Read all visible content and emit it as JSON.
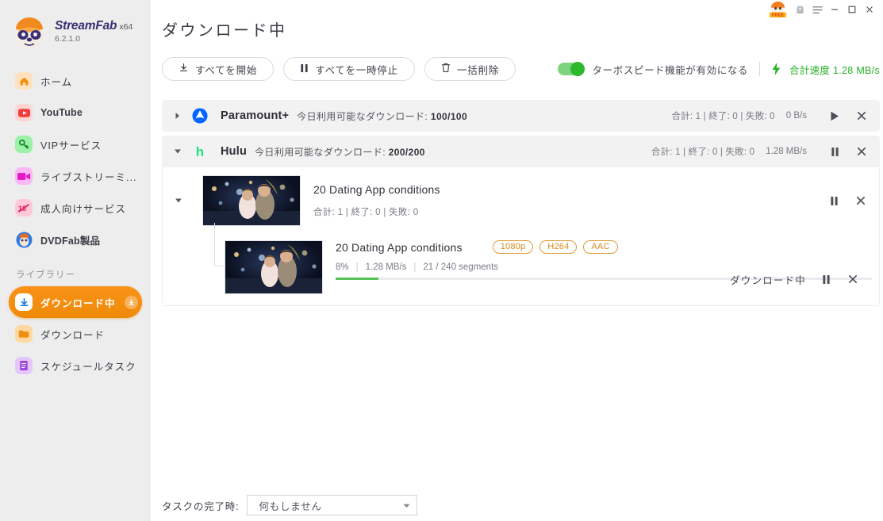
{
  "brand": {
    "name": "StreamFab",
    "arch": "x64",
    "version": "6.2.1.0"
  },
  "titlebar": {
    "free_badge": "free-badge-icon",
    "gift": "gift-icon",
    "menu": "hamburger-menu-icon",
    "minimize": "minimize-icon",
    "maximize": "maximize-icon",
    "close": "close-icon"
  },
  "sidebar": {
    "items": [
      {
        "label": "ホーム",
        "icon": "home-icon",
        "key": "home"
      },
      {
        "label": "YouTube",
        "icon": "youtube-icon",
        "key": "youtube"
      },
      {
        "label": "VIPサービス",
        "icon": "key-icon",
        "key": "vip"
      },
      {
        "label": "ライブストリーミ...",
        "icon": "video-camera-icon",
        "key": "livestream"
      },
      {
        "label": "成人向けサービス",
        "icon": "adult-18-icon",
        "key": "adult"
      },
      {
        "label": "DVDFab製品",
        "icon": "dvdfab-icon",
        "key": "dvdfab"
      }
    ],
    "library_title": "ライブラリー",
    "library_items": [
      {
        "label": "ダウンロード中",
        "icon": "download-icon",
        "key": "downloading",
        "active": true,
        "badge": "download-badge-icon"
      },
      {
        "label": "ダウンロード",
        "icon": "folder-icon",
        "key": "downloads",
        "active": false
      },
      {
        "label": "スケジュールタスク",
        "icon": "schedule-icon",
        "key": "scheduled",
        "active": false
      }
    ]
  },
  "page": {
    "title": "ダウンロード中"
  },
  "toolbar": {
    "start_all": "すべてを開始",
    "pause_all": "すべてを一時停止",
    "delete_all": "一括削除",
    "turbo_label": "ターボスピード機能が有効になる",
    "turbo_on": true,
    "total_speed_label": "合計速度",
    "total_speed_value": "1.28 MB/s"
  },
  "colors": {
    "accent": "#f2900d",
    "green": "#25b025",
    "badge_border": "#e09a34",
    "paramount_blue": "#0064ff",
    "hulu_green": "#1ce783"
  },
  "groups": [
    {
      "site": "Paramount+",
      "logo": "paramount-logo-icon",
      "quota_label": "今日利用可能なダウンロード:",
      "quota_value": "100/100",
      "expanded": false,
      "stats": "合計: 1 | 終了: 0 | 失敗: 0",
      "speed": "0 B/s",
      "action_icon": "play-icon",
      "close_icon": "close-icon",
      "tasks": []
    },
    {
      "site": "Hulu",
      "logo": "hulu-logo-icon",
      "quota_label": "今日利用可能なダウンロード:",
      "quota_value": "200/200",
      "expanded": true,
      "stats": "合計: 1 | 終了: 0 | 失敗: 0",
      "speed": "1.28 MB/s",
      "action_icon": "pause-icon",
      "close_icon": "close-icon",
      "tasks": [
        {
          "title": "20 Dating App conditions",
          "stats": "合計: 1 |  終了: 0 |  失敗: 0",
          "expanded": true,
          "action_icon": "pause-icon",
          "close_icon": "close-icon",
          "items": [
            {
              "title": "20 Dating App conditions",
              "badges": [
                "1080p",
                "H264",
                "AAC"
              ],
              "percent": "8%",
              "percent_value": 8,
              "speed": "1.28 MB/s",
              "segments": "21 / 240 segments",
              "status": "ダウンロード中",
              "action_icon": "pause-icon",
              "close_icon": "close-icon"
            }
          ]
        }
      ]
    }
  ],
  "footer": {
    "label": "タスクの完了時:",
    "selected": "何もしません"
  }
}
